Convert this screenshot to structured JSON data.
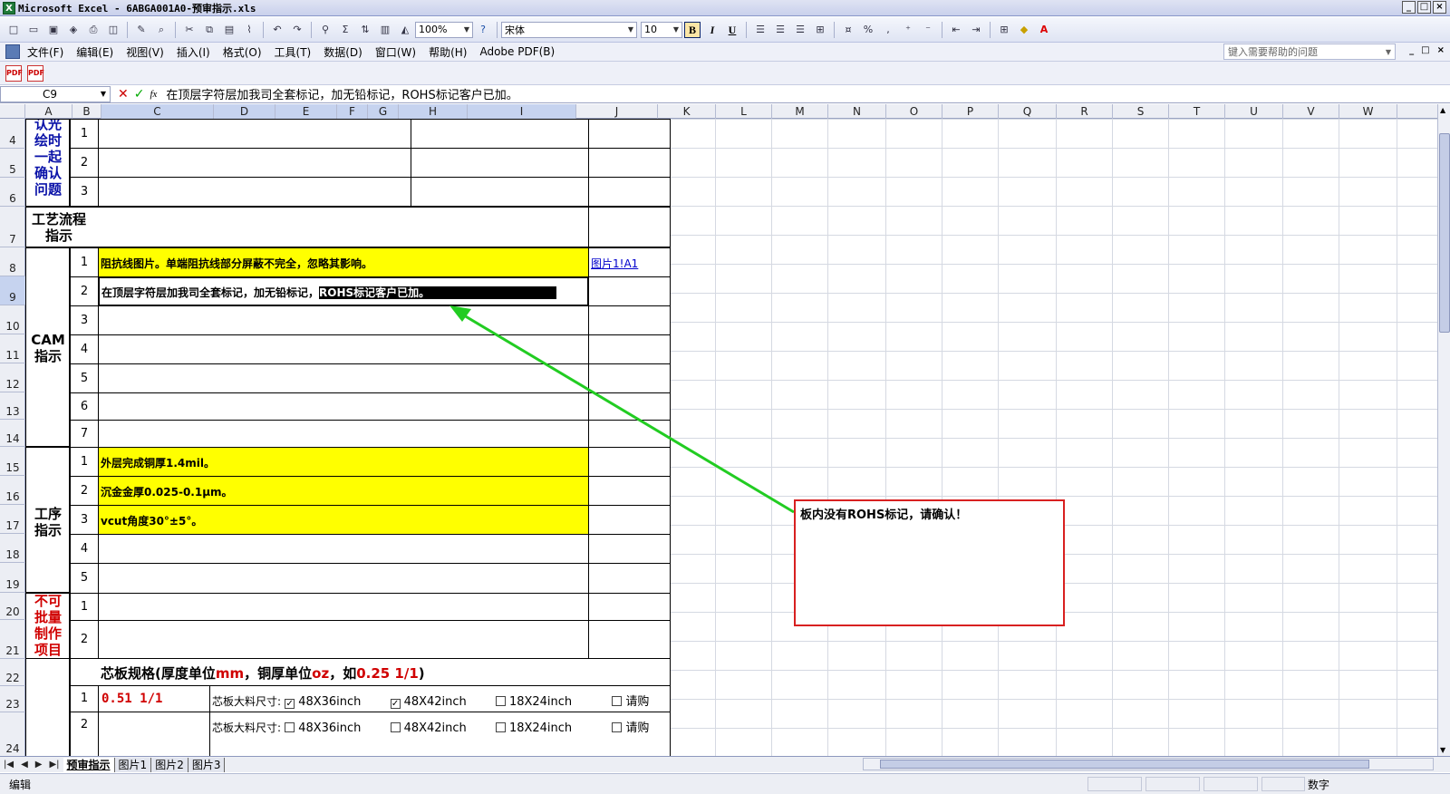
{
  "window": {
    "title": "Microsoft Excel - 6ABGA001A0-预审指示.xls",
    "app_icon": "excel-icon",
    "controls": [
      "_",
      "□",
      "×"
    ]
  },
  "toolbar": {
    "zoom": "100%",
    "font_name": "宋体",
    "font_size": "10",
    "bold_label": "B",
    "italic_label": "I",
    "underline_label": "U",
    "sum_label": "Σ",
    "percent_label": "%",
    "comma_label": ","
  },
  "menu": {
    "items": [
      "文件(F)",
      "编辑(E)",
      "视图(V)",
      "插入(I)",
      "格式(O)",
      "工具(T)",
      "数据(D)",
      "窗口(W)",
      "帮助(H)",
      "Adobe PDF(B)"
    ],
    "help_placeholder": "键入需要帮助的问题"
  },
  "formula_bar": {
    "name_box": "C9",
    "fx": "fx",
    "content": "在顶层字符层加我司全套标记，加无铅标记，ROHS标记客户已加。"
  },
  "columns": [
    "A",
    "B",
    "C",
    "D",
    "E",
    "F",
    "G",
    "H",
    "I",
    "J",
    "K",
    "L",
    "M",
    "N",
    "O",
    "P",
    "Q",
    "R",
    "S",
    "T",
    "U",
    "V",
    "W"
  ],
  "rows": [
    "4",
    "5",
    "6",
    "7",
    "8",
    "9",
    "10",
    "11",
    "12",
    "13",
    "14",
    "15",
    "16",
    "17",
    "18",
    "19",
    "20",
    "21",
    "22",
    "23",
    "24"
  ],
  "sheet": {
    "section_confirm": "认光绘时一起确认问题",
    "section_process": "工艺流程指示",
    "section_cam_line1": "CAM",
    "section_cam_line2": "指示",
    "section_procedure": "工序指示",
    "section_nonbatch": "不可批量制作项目",
    "numbers": [
      "1",
      "2",
      "3",
      "4",
      "5",
      "6",
      "7"
    ],
    "cam1": "阻抗线图片。单端阻抗线部分屏蔽不完全，忽略其影响。",
    "cam1_link": "图片1!A1",
    "cam2_prefix": "在顶层字符层加我司全套标记，加无铅标记，",
    "cam2_selected": "ROHS标记客户已加。",
    "proc1": "外层完成铜厚1.4mil。",
    "proc2": "沉金金厚0.025-0.1μm。",
    "proc3": "vcut角度30°±5°。",
    "core_title_a": "芯板规格(厚度单位",
    "core_title_mm": "mm",
    "core_title_b": "，铜厚单位",
    "core_title_oz": "oz",
    "core_title_c": "，如",
    "core_title_eg": "0.25 1/1",
    "core_title_d": ")",
    "core1_value": "0.51 1/1",
    "core_size_label": "芯板大料尺寸:",
    "opt_48x36": "48X36inch",
    "opt_48x42": "48X42inch",
    "opt_18x24": "18X24inch",
    "opt_buy": "请购",
    "check_mark": "✓",
    "comment": "板内没有ROHS标记，请确认！"
  },
  "sheet_tabs": [
    "预审指示",
    "图片1",
    "图片2",
    "图片3"
  ],
  "status": {
    "mode": "编辑",
    "num": "数字"
  },
  "colors": {
    "highlight_yellow": "#ffff00",
    "arrow_green": "#22cc22",
    "comment_border": "#d82020"
  }
}
